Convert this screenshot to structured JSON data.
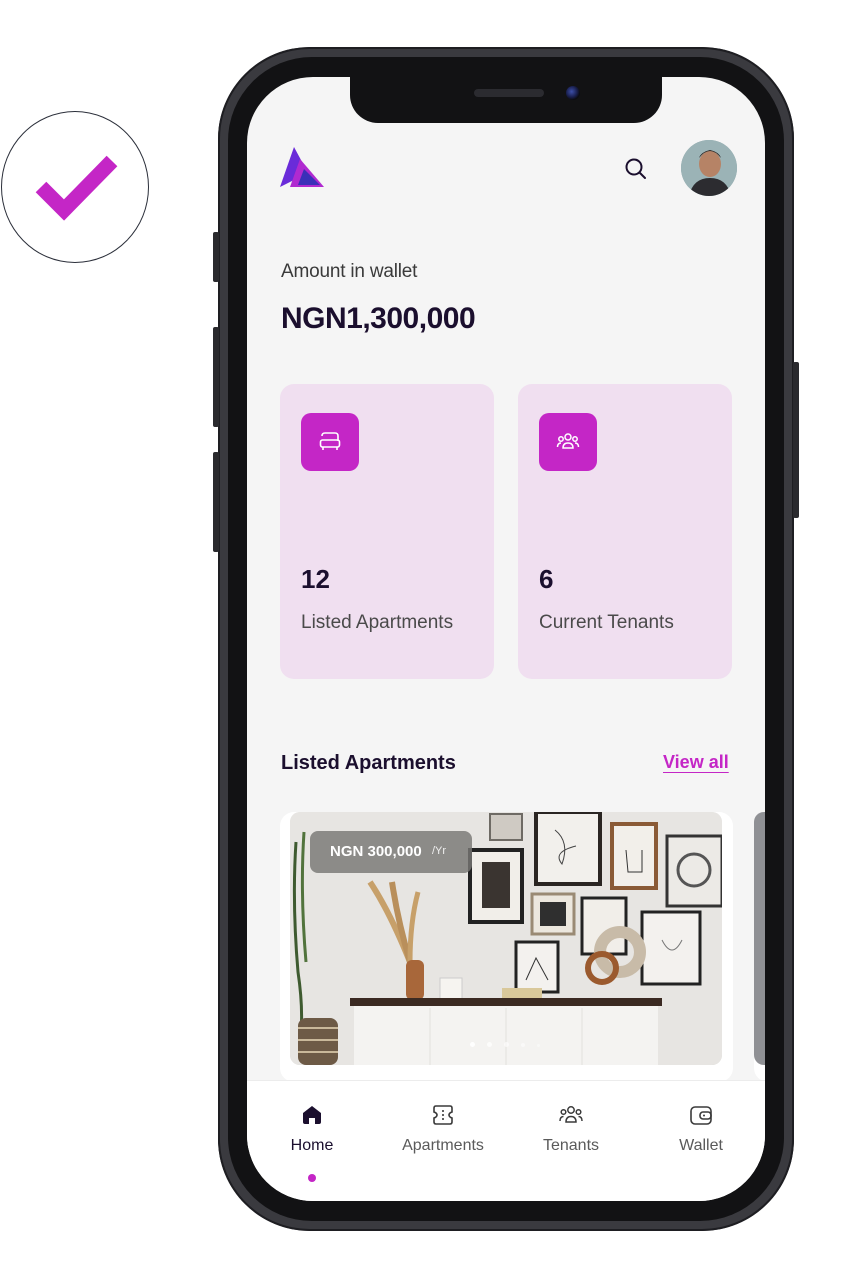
{
  "wallet": {
    "label": "Amount in wallet",
    "amount": "NGN1,300,000"
  },
  "stats": [
    {
      "value": "12",
      "label": "Listed Apartments",
      "icon": "bed-icon"
    },
    {
      "value": "6",
      "label": "Current Tenants",
      "icon": "users-icon"
    }
  ],
  "listed": {
    "title": "Listed Apartments",
    "view_all": "View all",
    "card": {
      "price": "NGN 300,000",
      "period": "/Yr"
    }
  },
  "nav": [
    {
      "label": "Home",
      "icon": "home-icon",
      "active": true
    },
    {
      "label": "Apartments",
      "icon": "apartment-icon",
      "active": false
    },
    {
      "label": "Tenants",
      "icon": "users-icon",
      "active": false
    },
    {
      "label": "Wallet",
      "icon": "wallet-icon",
      "active": false
    }
  ],
  "colors": {
    "accent": "#c426c6",
    "card_bg": "#f0dff0",
    "text_dark": "#1b0f2e",
    "check": "#c426c6"
  }
}
